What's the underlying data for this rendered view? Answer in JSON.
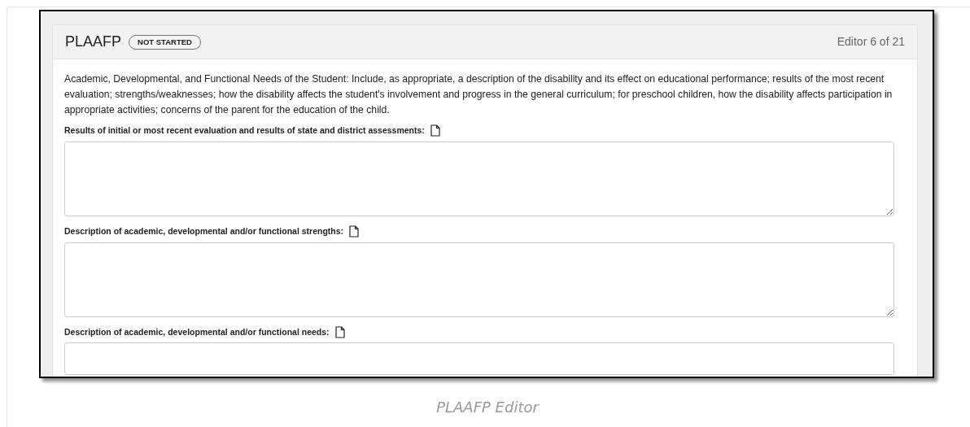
{
  "editor": {
    "title": "PLAAFP",
    "status": "NOT STARTED",
    "counter": "Editor 6 of 21",
    "description": "Academic, Developmental, and Functional Needs of the Student: Include, as appropriate, a description of the disability and its effect on educational performance; results of the most recent evaluation; strengths/weaknesses; how the disability affects the student's involvement and progress in the general curriculum; for preschool children, how the disability affects participation in appropriate activities; concerns of the parent for the education of the child.",
    "fields": [
      {
        "label": "Results of initial or most recent evaluation and results of state and district assessments:"
      },
      {
        "label": "Description of academic, developmental and/or functional strengths:"
      },
      {
        "label": "Description of academic, developmental and/or functional needs:"
      }
    ]
  },
  "caption": "PLAAFP Editor"
}
